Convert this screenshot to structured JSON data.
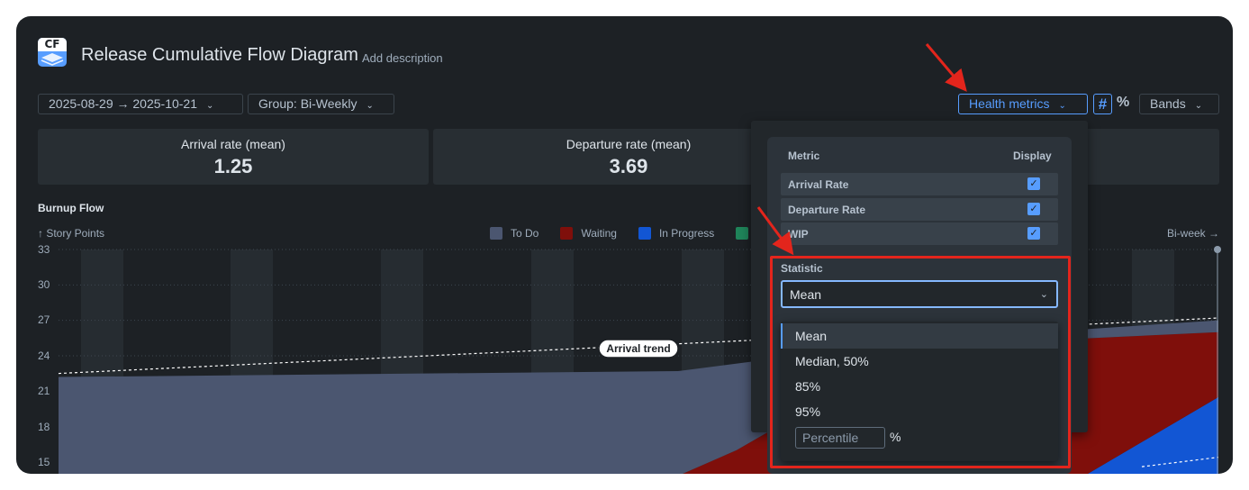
{
  "app": {
    "logo_text": "CF",
    "title": "Release Cumulative Flow Diagram",
    "add_description": "Add description"
  },
  "toolbar": {
    "date_range": "2025-08-29 → 2025-10-21",
    "group": "Group: Bi-Weekly",
    "health_metrics": "Health metrics",
    "count_toggle": "#",
    "percent_toggle": "%",
    "bands": "Bands"
  },
  "metrics": [
    {
      "label": "Arrival rate (mean)",
      "value": "1.25"
    },
    {
      "label": "Departure rate (mean)",
      "value": "3.69"
    }
  ],
  "chart_section": {
    "title": "Burnup Flow",
    "y_axis_label": "↑ Story Points",
    "x_axis_label": "Bi-week →",
    "trend_label": "Arrival trend"
  },
  "chart_data": {
    "type": "area",
    "title": "Burnup Flow",
    "ylabel": "↑ Story Points",
    "xlabel": "Bi-week →",
    "y_ticks": [
      "33",
      "30",
      "27",
      "24",
      "21",
      "18",
      "15"
    ],
    "ylim": [
      14,
      33
    ],
    "legend": [
      "To Do",
      "Waiting",
      "In Progress"
    ],
    "colors": {
      "To Do": "#4b5670",
      "Waiting": "#7f0f0b",
      "In Progress": "#1256d4",
      "Done": "#1f845a"
    },
    "grid": true
  },
  "health_panel": {
    "col_metric": "Metric",
    "col_display": "Display",
    "rows": [
      {
        "label": "Arrival Rate",
        "checked": true
      },
      {
        "label": "Departure Rate",
        "checked": true
      },
      {
        "label": "WIP",
        "checked": true
      }
    ],
    "statistic_label": "Statistic",
    "statistic_value": "Mean",
    "options": [
      "Mean",
      "Median, 50%",
      "85%",
      "95%"
    ],
    "percentile_placeholder": "Percentile",
    "percentile_unit": "%"
  },
  "colors": {
    "accent": "#579dff",
    "annotation": "#e3251c"
  }
}
